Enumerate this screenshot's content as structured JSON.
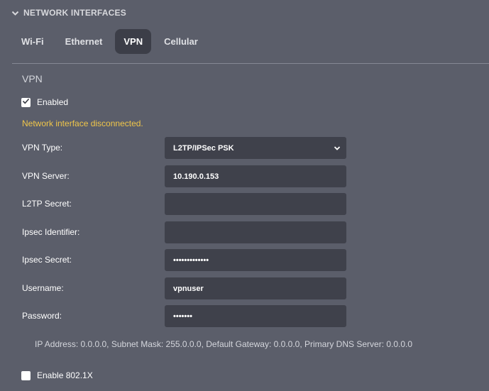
{
  "section": {
    "title": "NETWORK INTERFACES"
  },
  "tabs": [
    {
      "label": "Wi-Fi",
      "active": false
    },
    {
      "label": "Ethernet",
      "active": false
    },
    {
      "label": "VPN",
      "active": true
    },
    {
      "label": "Cellular",
      "active": false
    }
  ],
  "vpn": {
    "title": "VPN",
    "enabled_label": "Enabled",
    "enabled_checked": true,
    "status_message": "Network interface disconnected.",
    "fields": {
      "vpn_type": {
        "label": "VPN Type:",
        "value": "L2TP/IPSec PSK"
      },
      "vpn_server": {
        "label": "VPN Server:",
        "value": "10.190.0.153"
      },
      "l2tp_secret": {
        "label": "L2TP Secret:",
        "value": ""
      },
      "ipsec_identifier": {
        "label": "Ipsec Identifier:",
        "value": ""
      },
      "ipsec_secret": {
        "label": "Ipsec Secret:",
        "value": "•••••••••••••"
      },
      "username": {
        "label": "Username:",
        "value": "vpnuser"
      },
      "password": {
        "label": "Password:",
        "value": "•••••••"
      }
    },
    "ip_info": "IP Address: 0.0.0.0, Subnet Mask: 255.0.0.0, Default Gateway: 0.0.0.0, Primary DNS Server: 0.0.0.0",
    "enable_8021x_label": "Enable 802.1X",
    "enable_8021x_checked": false
  },
  "colors": {
    "background": "#5b5e6a",
    "field_background": "#3f414b",
    "active_tab": "#3c3e48",
    "warning": "#f0c64a"
  },
  "icons": {
    "section_toggle": "chevron-down-icon",
    "select_toggle": "chevron-down-icon",
    "checkbox_checked": "check-icon"
  }
}
